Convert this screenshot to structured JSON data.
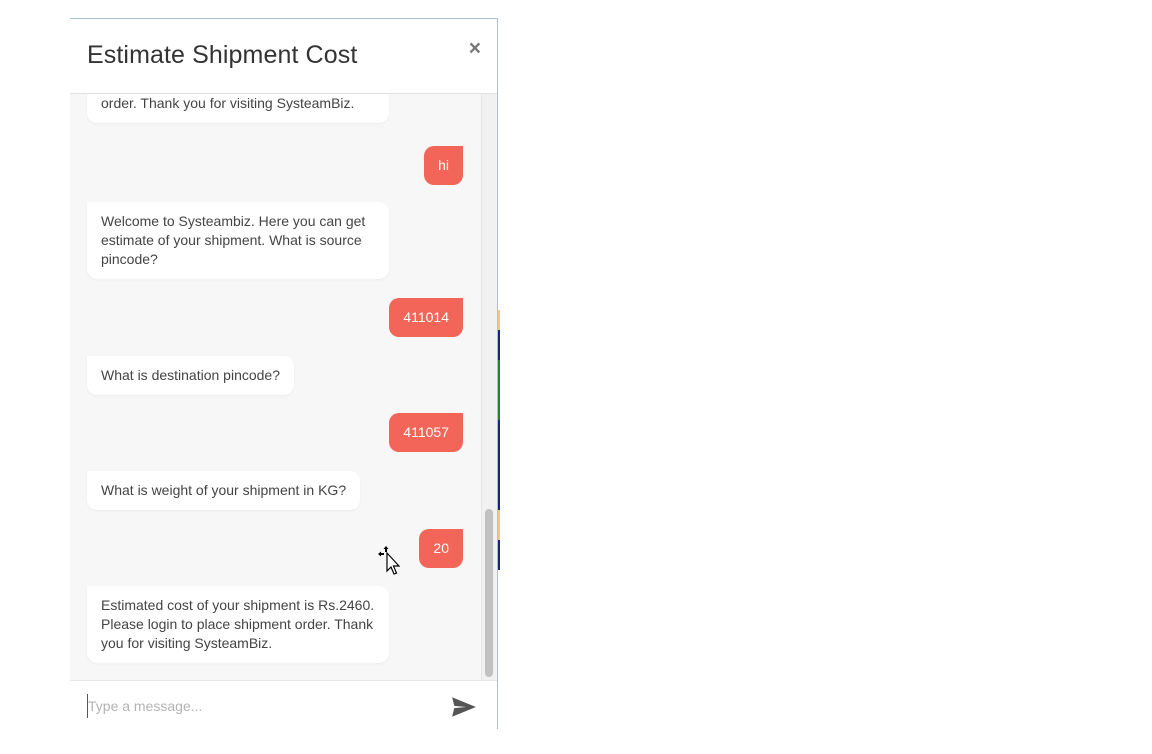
{
  "dialog": {
    "title": "Estimate Shipment Cost",
    "close_label": "×"
  },
  "messages": [
    {
      "from": "bot",
      "text": "order. Thank you for visiting SysteamBiz."
    },
    {
      "from": "user",
      "text": "hi"
    },
    {
      "from": "bot",
      "text": "Welcome to Systeambiz. Here you can get estimate of your shipment. What is source pincode?"
    },
    {
      "from": "user",
      "text": "411014"
    },
    {
      "from": "bot",
      "text": "What is destination pincode?"
    },
    {
      "from": "user",
      "text": "411057"
    },
    {
      "from": "bot",
      "text": "What is weight of your shipment in KG?"
    },
    {
      "from": "user",
      "text": "20"
    },
    {
      "from": "bot",
      "text": "Estimated cost of your shipment is Rs.2460. Please login to place shipment order. Thank you for visiting SysteamBiz."
    }
  ],
  "composer": {
    "placeholder": "Type a message...",
    "value": ""
  },
  "icons": {
    "close": "close-icon",
    "send": "send-icon",
    "cursor": "move-cursor-icon"
  },
  "colors": {
    "user_bubble": "#f36558",
    "bot_bubble": "#ffffff",
    "message_area": "#f7f7f7"
  }
}
